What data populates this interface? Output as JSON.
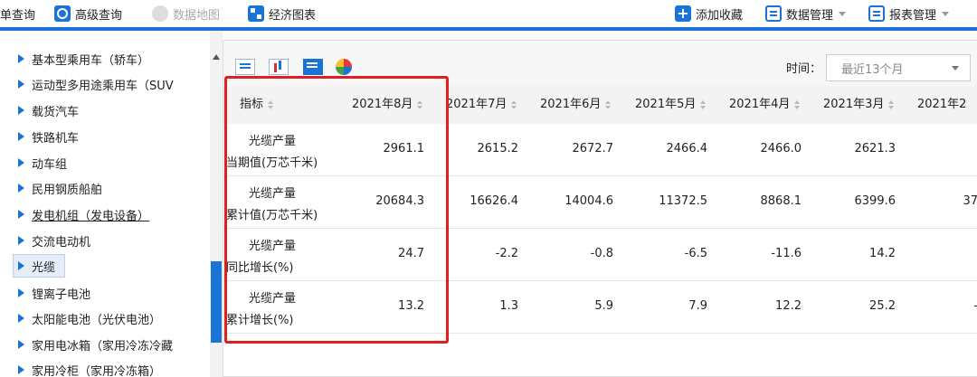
{
  "toolbar": {
    "simple_query": "单查询",
    "advanced_query": "高级查询",
    "data_map": "数据地图",
    "economic_charts": "经济图表",
    "add_favorite": "添加收藏",
    "data_manage": "数据管理",
    "report_manage": "报表管理"
  },
  "sidebar": {
    "items": [
      {
        "label": "基本型乘用车（轿车）"
      },
      {
        "label": "运动型多用途乘用车（SUV"
      },
      {
        "label": "载货汽车"
      },
      {
        "label": "铁路机车"
      },
      {
        "label": "动车组"
      },
      {
        "label": "民用钢质船舶"
      },
      {
        "label": "发电机组（发电设备）"
      },
      {
        "label": "交流电动机"
      },
      {
        "label": "光缆"
      },
      {
        "label": "锂离子电池"
      },
      {
        "label": "太阳能电池（光伏电池）"
      },
      {
        "label": "家用电冰箱（家用冷冻冷藏"
      },
      {
        "label": "家用冷柜（家用冷冻箱）"
      }
    ],
    "active_index": 8,
    "underlined_index": 6
  },
  "panel": {
    "time_label": "时间：",
    "time_value": "最近13个月"
  },
  "table": {
    "headers": [
      "指标",
      "2021年8月",
      "2021年7月",
      "2021年6月",
      "2021年5月",
      "2021年4月",
      "2021年3月",
      "2021年2"
    ],
    "rows": [
      {
        "label1": "光缆产量",
        "label2": "当期值(万芯千米)",
        "values": [
          "2961.1",
          "2615.2",
          "2672.7",
          "2466.4",
          "2466.0",
          "2621.3",
          ""
        ]
      },
      {
        "label1": "光缆产量",
        "label2": "累计值(万芯千米)",
        "values": [
          "20684.3",
          "16626.4",
          "14004.6",
          "11372.5",
          "8868.1",
          "6399.6",
          "37"
        ]
      },
      {
        "label1": "光缆产量",
        "label2": "同比增长(%)",
        "values": [
          "24.7",
          "-2.2",
          "-0.8",
          "-6.5",
          "-11.6",
          "14.2",
          ""
        ]
      },
      {
        "label1": "光缆产量",
        "label2": "累计增长(%)",
        "values": [
          "13.2",
          "1.3",
          "5.9",
          "7.9",
          "12.2",
          "25.2",
          "-"
        ]
      }
    ]
  },
  "colors": {
    "accent": "#1a73d6",
    "highlight": "#e02020"
  }
}
